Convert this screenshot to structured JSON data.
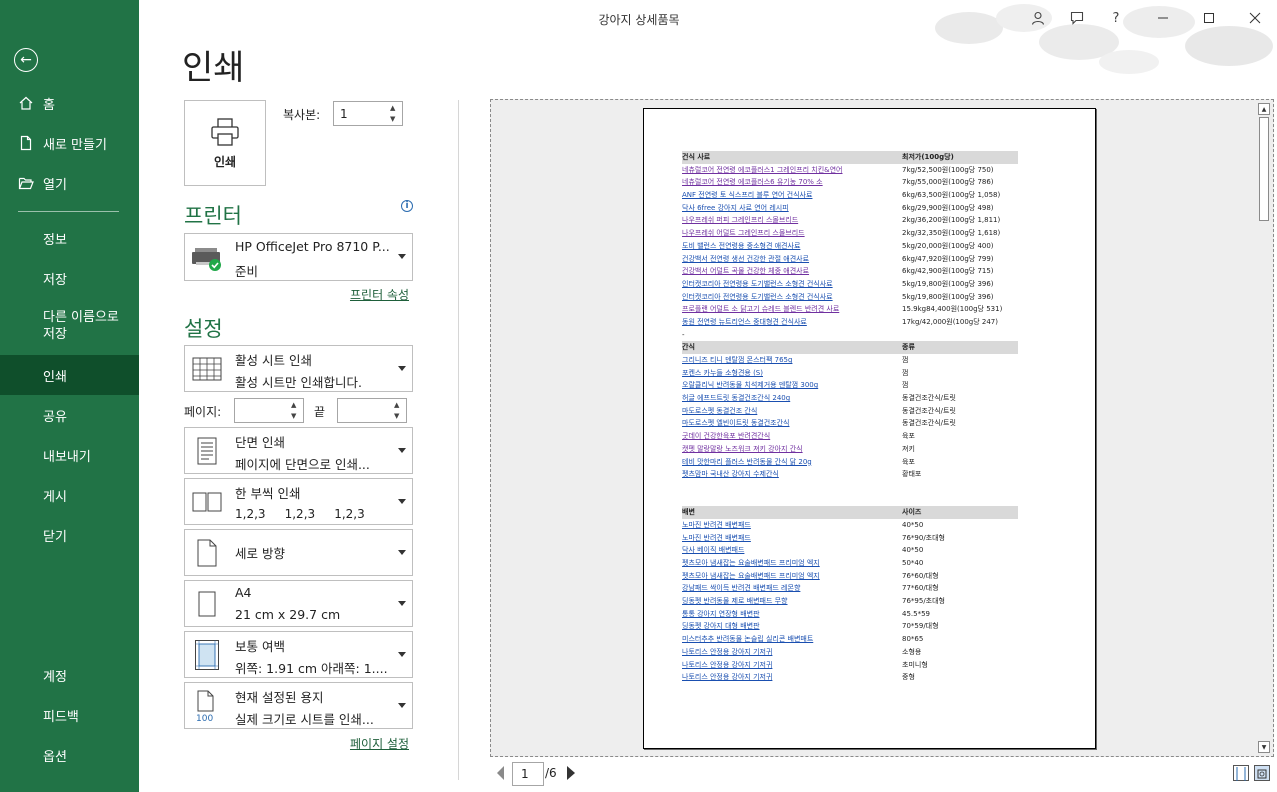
{
  "window": {
    "title": "강아지 상세품목"
  },
  "sidebar": {
    "back_label": "←",
    "items": [
      {
        "label": "홈"
      },
      {
        "label": "새로 만들기"
      },
      {
        "label": "열기"
      },
      {
        "label": "정보"
      },
      {
        "label": "저장"
      },
      {
        "label": "다른 이름으로 저장"
      },
      {
        "label": "인쇄"
      },
      {
        "label": "공유"
      },
      {
        "label": "내보내기"
      },
      {
        "label": "게시"
      },
      {
        "label": "닫기"
      },
      {
        "label": "계정"
      },
      {
        "label": "피드백"
      },
      {
        "label": "옵션"
      }
    ],
    "active": "인쇄"
  },
  "print": {
    "heading": "인쇄",
    "print_button_label": "인쇄",
    "copies_label": "복사본:",
    "copies_value": "1",
    "printer_section": "프린터",
    "printer_name": "HP OfficeJet Pro 8710 P...",
    "printer_status": "준비",
    "printer_properties_link": "프린터 속성",
    "settings_section": "설정",
    "settings": [
      {
        "line1": "활성 시트 인쇄",
        "line2": "활성 시트만 인쇄합니다."
      },
      {
        "line1": "단면 인쇄",
        "line2": "페이지에 단면으로 인쇄..."
      },
      {
        "line1": "한 부씩 인쇄",
        "line2": "1,2,3     1,2,3     1,2,3"
      },
      {
        "line1": "세로 방향",
        "line2": ""
      },
      {
        "line1": "A4",
        "line2": "21 cm x 29.7 cm"
      },
      {
        "line1": "보통 여백",
        "line2": "위쪽: 1.91 cm 아래쪽: 1...."
      },
      {
        "line1": "현재 설정된 용지",
        "line2": "실제 크기로 시트를 인쇄..."
      }
    ],
    "pages_label": "페이지:",
    "pages_from": "",
    "pages_to_label": "끝",
    "pages_to": "",
    "page_setup_link": "페이지 설정",
    "scaling_icon_text": "100"
  },
  "preview": {
    "current_page": "1",
    "total_pages": "/6",
    "sheet": {
      "section1": {
        "header": [
          "건식 사료",
          "최저가(100g당)"
        ],
        "rows": [
          [
            "네츄럴코어 전연령 에코플러스1 그레인프리 치킨&연어",
            "7kg/52,500원(100g당 750)"
          ],
          [
            "네츄럴코어 전연령 에코플러스6 유기농 70% 소",
            "7kg/55,000원(100g당 786)"
          ],
          [
            "ANF 전연령 토 식스프리 블루 연어 건식사료",
            "6kg/63,500원(100g당 1,058)"
          ],
          [
            "닥사 6free 강아지 사료 연어 레시피",
            "6kg/29,900원(100g당 498)"
          ],
          [
            "나우프레쉬 퍼피 그레인프리 스몰브리드",
            "2kg/36,200원(100g당 1,811)"
          ],
          [
            "나우프레쉬 어덜트 그레인프리 스몰브리드",
            "2kg/32,350원(100g당 1,618)"
          ],
          [
            "도비 밸런스 전연령용 중소형견 애견사료",
            "5kg/20,000원(100g당 400)"
          ],
          [
            "건강백서 전연령 생선 건강한 관절 애견사료",
            "6kg/47,920원(100g당 799)"
          ],
          [
            "건강백서 어덜트 곡물 건강한 체중 애견사료",
            "6kg/42,900원(100g당 715)"
          ],
          [
            "인터캣코리아 전연령용 도기밸런스 소형견 건식사료",
            "5kg/19,800원(100g당 396)"
          ],
          [
            "인터캣코리아 전연령용 도기밸런스 소형견 건식사료",
            "5kg/19,800원(100g당 396)"
          ],
          [
            "프로플랜 어덜트 소 닭고기 슈레드 블렌드 반려견 사료",
            "15.9kg84,400원(100g당 531)"
          ],
          [
            "동원 전연령 뉴트리언스 중대형견 건식사료",
            "17kg/42,000원(100g당 247)"
          ]
        ],
        "note": "-"
      },
      "section2": {
        "header": [
          "간식",
          "종류"
        ],
        "rows": [
          [
            "그리니즈 티니 덴탈껌 몬스터팩 765g",
            "껌"
          ],
          [
            "포켄스 카누들 소형견용 (S)",
            "껌"
          ],
          [
            "오랄클리닉 반려동물 치석제거용 덴탈껌 300g",
            "껌"
          ],
          [
            "허글 에프드트릿 동결건조간식 240g",
            "동결건조간식/트릿"
          ],
          [
            "마도로스펫 동결건조 간식",
            "동결건조간식/트릿"
          ],
          [
            "마도로스펫 엘빈이트릿 동결건조간식",
            "동결건조간식/트릿"
          ],
          [
            "굿데이 건강한육포 반려견간식",
            "육포"
          ],
          [
            "캣펫 말랑말랑 노즈워크 져키 강아지 간식",
            "져키"
          ],
          [
            "테비 맛한마리 플러스 반려동물 간식 닭 20g",
            "육포"
          ],
          [
            "펫츠맘마 국내산 강아지 수제간식",
            "황태포"
          ]
        ]
      },
      "section3": {
        "header": [
          "배변",
          "사이즈"
        ],
        "rows": [
          [
            "노마진 반려견 배변패드",
            "40*50"
          ],
          [
            "노마진 반려견 배변패드",
            "76*90/초대형"
          ],
          [
            "닥사 베이직 배변패드",
            "40*50"
          ],
          [
            "펫츠모아 냄새잡는 요술배변패드 프리미엄 엑지",
            "50*40"
          ],
          [
            "펫츠모아 냄새잡는 요술배변패드 프리미엄 엑지",
            "76*60/대형"
          ],
          [
            "강남패드 싹이득 반려견 배변패드 레몬향",
            "77*60/대형"
          ],
          [
            "딩동펫 반려동물 제로 배변패드 무향",
            "76*95/초대형"
          ],
          [
            "통통 강아지 연장형 배변판",
            "45.5*59"
          ],
          [
            "딩동펫 강아지 대형 배변판",
            "70*59/대형"
          ],
          [
            "미스터추추 반려동물 논슬립 실리콘 배변매트",
            "80*65"
          ],
          [
            "나토리스 안정용 강아지 기저귀",
            "소형용"
          ],
          [
            "나토리스 안정용 강아지 기저귀",
            "초미니형"
          ],
          [
            "나토리스 안정용 강아지 기저귀",
            "중형"
          ]
        ]
      }
    }
  }
}
